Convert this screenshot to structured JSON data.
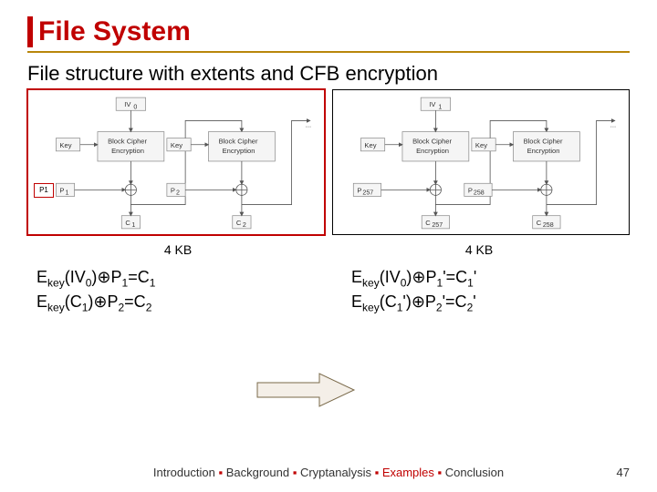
{
  "title": "File System",
  "subtitle": "File structure with extents and CFB encryption",
  "diagram": {
    "left": {
      "iv": "IV0",
      "key": "Key",
      "block": "Block Cipher\nEncryption",
      "p": [
        "P1",
        "P2"
      ],
      "c": [
        "C1",
        "C2"
      ],
      "ellipsis": "..."
    },
    "right": {
      "iv": "IV1",
      "key": "Key",
      "block": "Block Cipher\nEncryption",
      "p": [
        "P257",
        "P258"
      ],
      "c": [
        "C257",
        "C258"
      ],
      "ellipsis": "..."
    },
    "p1_box": "P1"
  },
  "size_labels": {
    "left": "4 KB",
    "right": "4 KB"
  },
  "equations": {
    "left": [
      {
        "e": "E",
        "ksub": "key",
        "arg": "(IV",
        "argsub": "0",
        "after": ")⊕P",
        "psub": "1",
        "eq": "=C",
        "csub": "1"
      },
      {
        "e": "E",
        "ksub": "key",
        "arg": "(C",
        "argsub": "1",
        "after": ")⊕P",
        "psub": "2",
        "eq": "=C",
        "csub": "2"
      }
    ],
    "right": [
      {
        "e": "E",
        "ksub": "key",
        "arg": "(IV",
        "argsub": "0",
        "after": ")⊕P",
        "psub": "1",
        "prime1": "'",
        "eq": "=C",
        "csub": "1",
        "prime2": "'"
      },
      {
        "e": "E",
        "ksub": "key",
        "arg": "(C",
        "argsub": "1",
        "mid_prime": "'",
        "after": ")⊕P",
        "psub": "2",
        "prime1": "'",
        "eq": "=C",
        "csub": "2",
        "prime2": "'"
      }
    ]
  },
  "footer": {
    "items": [
      "Introduction",
      "Background",
      "Cryptanalysis",
      "Examples",
      "Conclusion"
    ],
    "highlight_index": 3,
    "sep": " ▪ "
  },
  "page_number": "47"
}
